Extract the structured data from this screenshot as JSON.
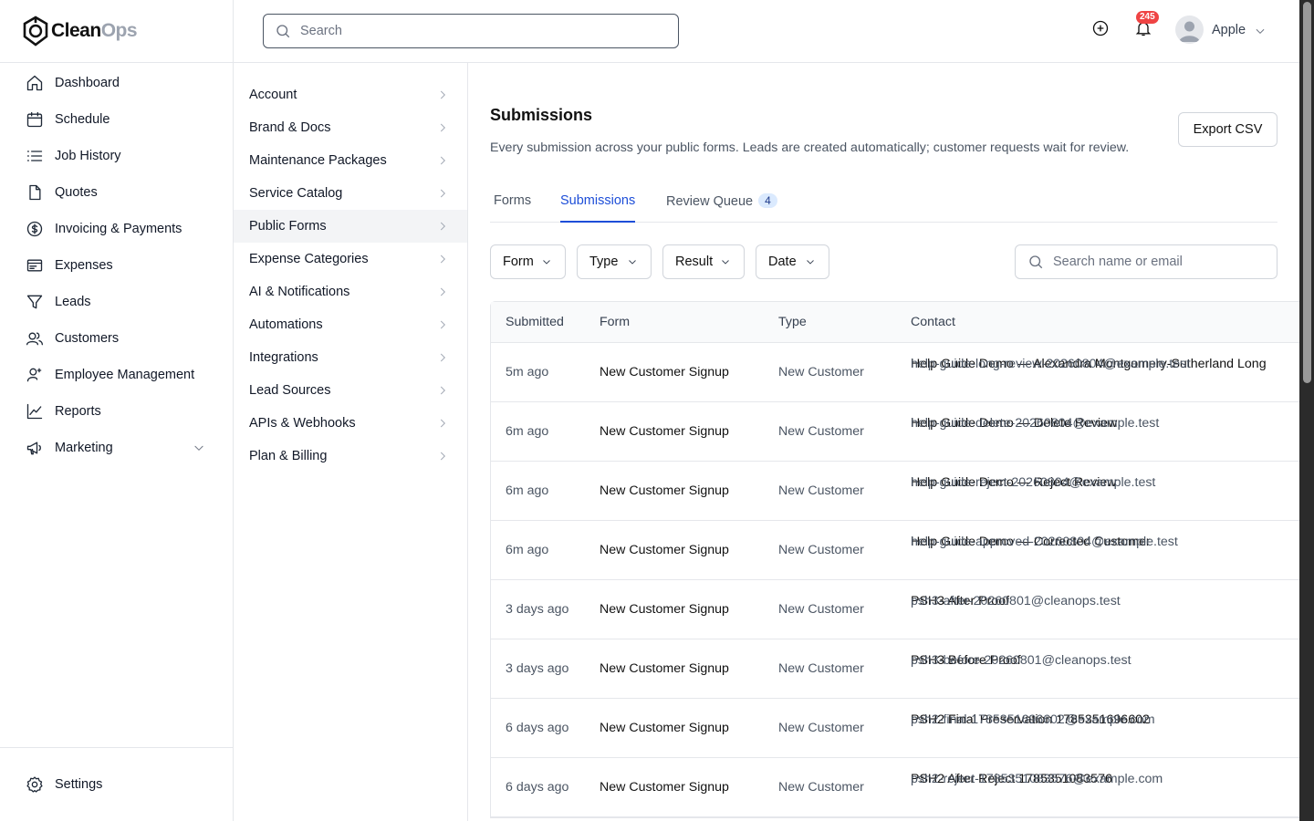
{
  "brand": {
    "part1": "Clean",
    "part2": "Ops"
  },
  "sidebar": {
    "items": [
      {
        "label": "Dashboard",
        "icon": "home-icon"
      },
      {
        "label": "Schedule",
        "icon": "calendar-icon"
      },
      {
        "label": "Job History",
        "icon": "list-icon"
      },
      {
        "label": "Quotes",
        "icon": "document-icon"
      },
      {
        "label": "Invoicing & Payments",
        "icon": "dollar-icon"
      },
      {
        "label": "Expenses",
        "icon": "receipt-icon"
      },
      {
        "label": "Leads",
        "icon": "filter-icon"
      },
      {
        "label": "Customers",
        "icon": "users-icon"
      },
      {
        "label": "Employee Management",
        "icon": "user-settings-icon"
      },
      {
        "label": "Reports",
        "icon": "chart-icon"
      },
      {
        "label": "Marketing",
        "icon": "megaphone-icon"
      }
    ],
    "settings_label": "Settings"
  },
  "topbar": {
    "search_placeholder": "Search",
    "notification_count": "245",
    "user_name": "Apple"
  },
  "subnav": {
    "items": [
      "Account",
      "Brand & Docs",
      "Maintenance Packages",
      "Service Catalog",
      "Public Forms",
      "Expense Categories",
      "AI & Notifications",
      "Automations",
      "Integrations",
      "Lead Sources",
      "APIs & Webhooks",
      "Plan & Billing"
    ],
    "active": "Public Forms"
  },
  "main": {
    "title": "Submissions",
    "description": "Every submission across your public forms. Leads are created automatically; customer requests wait for review.",
    "export_label": "Export CSV",
    "tabs": [
      {
        "label": "Forms"
      },
      {
        "label": "Submissions",
        "active": true
      },
      {
        "label": "Review Queue",
        "count": "4"
      }
    ],
    "filters": [
      "Form",
      "Type",
      "Result",
      "Date"
    ],
    "filter_search_placeholder": "Search name or email",
    "table": {
      "headers": [
        "Submitted",
        "Form",
        "Type",
        "Contact"
      ],
      "rows": [
        {
          "submitted": "5m ago",
          "form": "New Customer Signup",
          "type": "New Customer",
          "name": "Help Guide Demo — Alexandra Montgomery-Sutherland Long",
          "email": "help-guide-long-review-20260804@example.test"
        },
        {
          "submitted": "6m ago",
          "form": "New Customer Signup",
          "type": "New Customer",
          "name": "Help Guide Demo — Delete Review",
          "email": "help-guide-delete-20260804@example.test"
        },
        {
          "submitted": "6m ago",
          "form": "New Customer Signup",
          "type": "New Customer",
          "name": "Help Guide Demo — Reject Review",
          "email": "help-guide-reject-20260804@example.test"
        },
        {
          "submitted": "6m ago",
          "form": "New Customer Signup",
          "type": "New Customer",
          "name": "Help Guide Demo — Corrected Customer",
          "email": "help-guide-approved-20260804@example.test"
        },
        {
          "submitted": "3 days ago",
          "form": "New Customer Signup",
          "type": "New Customer",
          "name": "PSH3 After Proof",
          "email": "psh3-after-20260801@cleanops.test"
        },
        {
          "submitted": "3 days ago",
          "form": "New Customer Signup",
          "type": "New Customer",
          "name": "PSH3 Before Proof",
          "email": "psh3-before-20260801@cleanops.test"
        },
        {
          "submitted": "6 days ago",
          "form": "New Customer Signup",
          "type": "New Customer",
          "name": "PSH2 Final Preservation 1785351696602",
          "email": "psh2-final-1785351696602@example.com"
        },
        {
          "submitted": "6 days ago",
          "form": "New Customer Signup",
          "type": "New Customer",
          "name": "PSH2 After Reject 1785351083576",
          "email": "psh2-reject-1785351083576@example.com"
        }
      ]
    }
  },
  "colors": {
    "accent": "#1d4ed8",
    "badge": "#ef4444",
    "border": "#e5e7eb"
  }
}
